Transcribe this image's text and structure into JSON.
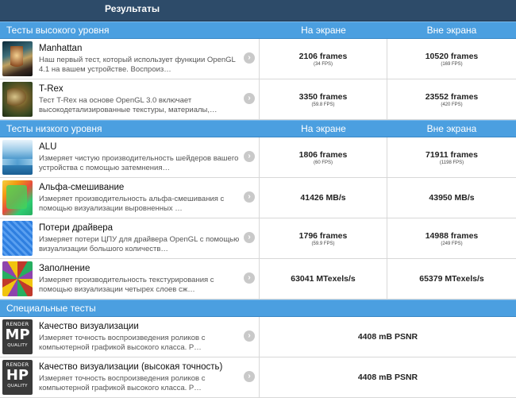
{
  "header": {
    "title": "Результаты"
  },
  "sections": {
    "high": {
      "name": "Тесты высокого уровня",
      "col1": "На экране",
      "col2": "Вне экрана"
    },
    "low": {
      "name": "Тесты низкого уровня",
      "col1": "На экране",
      "col2": "Вне экрана"
    },
    "special": {
      "name": "Специальные тесты"
    }
  },
  "high_tests": [
    {
      "name": "Manhattan",
      "desc": "Наш первый тест, который использует функции OpenGL 4.1 на вашем устройстве. Воспроиз…",
      "on": "2106 frames",
      "on_fps": "(34 FPS)",
      "off": "10520 frames",
      "off_fps": "(169 FPS)"
    },
    {
      "name": "T-Rex",
      "desc": "Тест T-Rex на основе OpenGL 3.0 включает высокодетализированные текстуры, материалы,…",
      "on": "3350 frames",
      "on_fps": "(59.8 FPS)",
      "off": "23552 frames",
      "off_fps": "(420 FPS)"
    }
  ],
  "low_tests": [
    {
      "name": "ALU",
      "desc": "Измеряет чистую производительность шейдеров вашего устройства с помощью затемнения…",
      "on": "1806 frames",
      "on_fps": "(60 FPS)",
      "off": "71911 frames",
      "off_fps": "(1198 FPS)"
    },
    {
      "name": "Альфа-смешивание",
      "desc": "Измеряет производительность альфа-смешивания с помощью визуализации выровненных …",
      "on": "41426 MB/s",
      "on_fps": "",
      "off": "43950 MB/s",
      "off_fps": ""
    },
    {
      "name": "Потери драйвера",
      "desc": "Измеряет потери ЦПУ для драйвера OpenGL с помощью визуализации большого количеств…",
      "on": "1796 frames",
      "on_fps": "(59.9 FPS)",
      "off": "14988 frames",
      "off_fps": "(249 FPS)"
    },
    {
      "name": "Заполнение",
      "desc": "Измеряет производительность текстурирования с помощью визуализации четырех слоев сж…",
      "on": "63041 MTexels/s",
      "on_fps": "",
      "off": "65379 MTexels/s",
      "off_fps": ""
    }
  ],
  "special_tests": [
    {
      "name": "Качество визуализации",
      "desc": "Измеряет точность воспроизведения роликов с компьютерной графикой высокого класса. Р…",
      "value": "4408 mB PSNR",
      "badge_top": "RENDER",
      "badge_mid": "MP",
      "badge_bot": "QUALITY"
    },
    {
      "name": "Качество визуализации (высокая точность)",
      "desc": "Измеряет точность воспроизведения роликов с компьютерной графикой высокого класса. Р…",
      "value": "4408 mB PSNR",
      "badge_top": "RENDER",
      "badge_mid": "HP",
      "badge_bot": "QUALITY"
    }
  ],
  "icons": {
    "chevron": "chevron-right-icon"
  },
  "colors": {
    "header": "#2d4b69",
    "section": "#4b9fe0"
  }
}
